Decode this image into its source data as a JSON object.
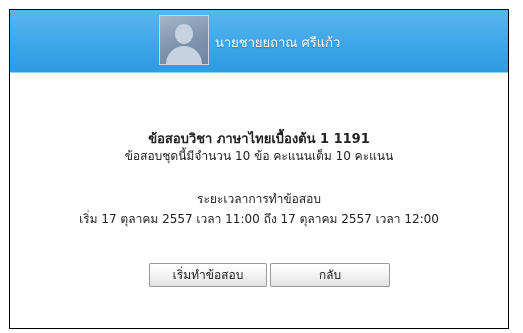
{
  "header": {
    "user_name": "นายชายยถาณ ศรีแก้ว"
  },
  "exam": {
    "title": "ข้อสอบวิชา ภาษาไทยเบื้องต้น 1 1191",
    "description": "ข้อสอบชุดนี้มีจำนวน 10 ข้อ คะแนนเต็ม 10 คะแนน",
    "period_title": "ระยะเวลาการทำข้อสอบ",
    "period_range": "เริ่ม 17 ตุลาคม 2557 เวลา 11:00 ถึง 17 ตุลาคม 2557 เวลา 12:00"
  },
  "buttons": {
    "start_label": "เริ่มทำข้อสอบ",
    "back_label": "กลับ"
  },
  "colors": {
    "header_bg": "#3ea6e8",
    "header_text": "#ffffff",
    "dialog_border": "#000000"
  },
  "icons": {
    "avatar": "user-avatar-placeholder"
  }
}
